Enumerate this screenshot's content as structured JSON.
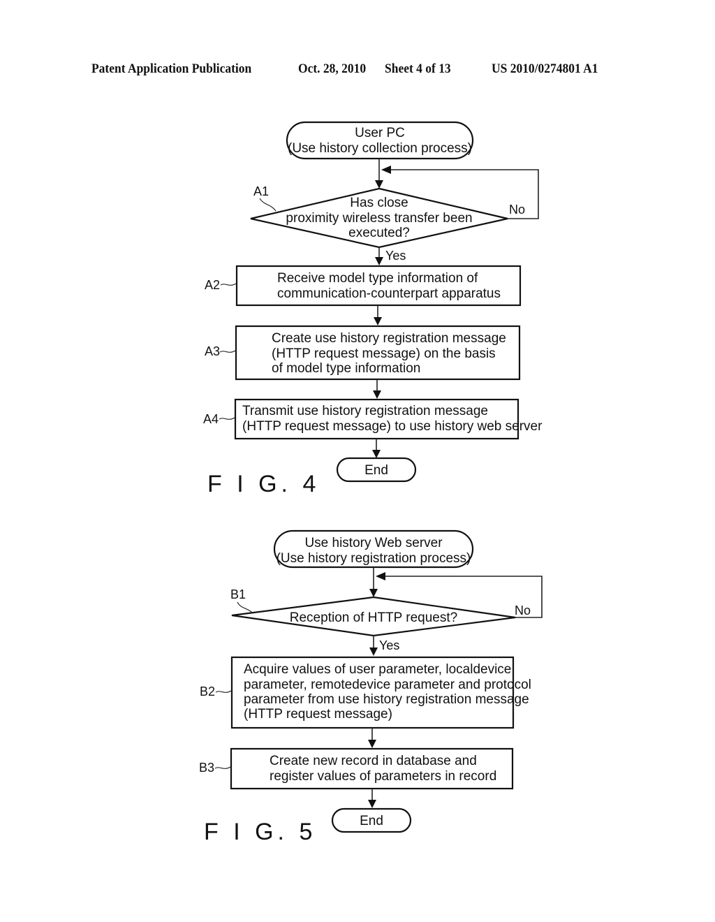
{
  "header": {
    "publication": "Patent Application Publication",
    "date": "Oct. 28, 2010",
    "sheet": "Sheet 4 of 13",
    "number": "US 2010/0274801 A1"
  },
  "fig4": {
    "caption": "F I G. 4",
    "start": {
      "lines": [
        "User PC",
        "(Use history collection process)"
      ]
    },
    "steps": [
      {
        "id": "A1",
        "type": "decision",
        "lines": [
          "Has close",
          "proximity wireless transfer been",
          "executed?"
        ],
        "yes_label": "Yes",
        "no_label": "No"
      },
      {
        "id": "A2",
        "type": "process",
        "lines": [
          "Receive model type information of",
          "communication-counterpart apparatus"
        ]
      },
      {
        "id": "A3",
        "type": "process",
        "lines": [
          "Create use history registration message",
          "(HTTP request message) on the basis",
          "of model type information"
        ]
      },
      {
        "id": "A4",
        "type": "process",
        "lines": [
          "Transmit use history registration message",
          "(HTTP request message) to use history web server"
        ]
      }
    ],
    "end": {
      "lines": [
        "End"
      ]
    }
  },
  "fig5": {
    "caption": "F I G. 5",
    "start": {
      "lines": [
        "Use history Web server",
        "(Use history registration process)"
      ]
    },
    "steps": [
      {
        "id": "B1",
        "type": "decision",
        "lines": [
          "Reception of HTTP request?"
        ],
        "yes_label": "Yes",
        "no_label": "No"
      },
      {
        "id": "B2",
        "type": "process",
        "lines": [
          "Acquire values of user parameter, localdevice",
          "parameter, remotedevice parameter and protocol",
          "parameter from use history registration message",
          "(HTTP request message)"
        ]
      },
      {
        "id": "B3",
        "type": "process",
        "lines": [
          "Create new record in database and",
          "register values of parameters in record"
        ]
      }
    ],
    "end": {
      "lines": [
        "End"
      ]
    }
  }
}
